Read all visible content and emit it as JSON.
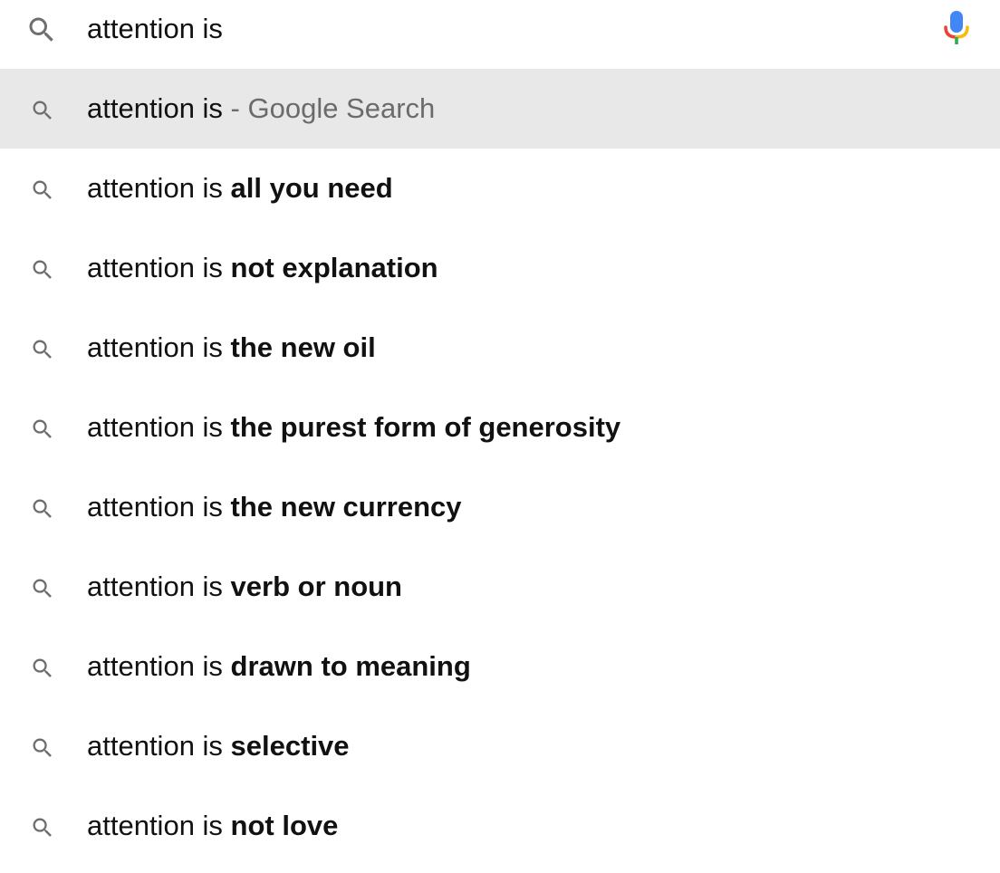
{
  "search": {
    "query": "attention is",
    "search_icon": "search-icon",
    "mic_icon": "microphone-icon"
  },
  "colors": {
    "highlight_bg": "#e8e8e8",
    "icon_gray": "#6e6e6e",
    "hint_gray": "#6b6b6b",
    "mic_blue": "#4285f4",
    "mic_red": "#ea4335",
    "mic_yellow": "#fbbc05",
    "mic_green": "#34a853"
  },
  "suggestions": [
    {
      "prefix": "attention is",
      "completion": "",
      "hint": " - Google Search",
      "icon": "search-icon",
      "highlighted": true
    },
    {
      "prefix": "attention is ",
      "completion": "all you need",
      "hint": "",
      "icon": "search-icon",
      "highlighted": false
    },
    {
      "prefix": "attention is ",
      "completion": "not explanation",
      "hint": "",
      "icon": "search-icon",
      "highlighted": false
    },
    {
      "prefix": "attention is ",
      "completion": "the new oil",
      "hint": "",
      "icon": "search-icon",
      "highlighted": false
    },
    {
      "prefix": "attention is ",
      "completion": "the purest form of generosity",
      "hint": "",
      "icon": "search-icon",
      "highlighted": false
    },
    {
      "prefix": "attention is ",
      "completion": "the new currency",
      "hint": "",
      "icon": "search-icon",
      "highlighted": false
    },
    {
      "prefix": "attention is ",
      "completion": "verb or noun",
      "hint": "",
      "icon": "search-icon",
      "highlighted": false
    },
    {
      "prefix": "attention is ",
      "completion": "drawn to meaning",
      "hint": "",
      "icon": "search-icon",
      "highlighted": false
    },
    {
      "prefix": "attention is ",
      "completion": "selective",
      "hint": "",
      "icon": "search-icon",
      "highlighted": false
    },
    {
      "prefix": "attention is ",
      "completion": "not love",
      "hint": "",
      "icon": "search-icon",
      "highlighted": false
    }
  ]
}
